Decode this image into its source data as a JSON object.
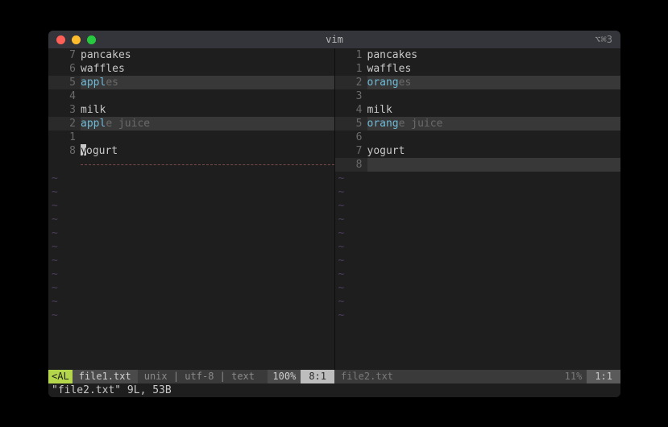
{
  "window": {
    "title": "vim",
    "indicator": "⌥⌘3"
  },
  "left": {
    "lines": [
      {
        "num": "7",
        "text": "pancakes",
        "diff": false
      },
      {
        "num": "6",
        "text": "waffles",
        "diff": false
      },
      {
        "num": "5",
        "pre": "appl",
        "rest": "es",
        "diff": true
      },
      {
        "num": "4",
        "text": "",
        "diff": false
      },
      {
        "num": "3",
        "text": "milk",
        "diff": false
      },
      {
        "num": "2",
        "pre": "appl",
        "rest": "e juice",
        "diff": true
      },
      {
        "num": "1",
        "text": "",
        "diff": false
      },
      {
        "num": "8",
        "cursor": "y",
        "rest": "ogurt",
        "diff": false
      }
    ],
    "fill": true,
    "status": {
      "indicator": "<AL",
      "file": "file1.txt",
      "meta": "unix | utf-8 | text",
      "pct": "100%",
      "pos": "8:1"
    }
  },
  "right": {
    "lines": [
      {
        "num": "1",
        "text": "pancakes",
        "diff": false
      },
      {
        "num": "1",
        "text": "waffles",
        "diff": false
      },
      {
        "num": "2",
        "pre": "orang",
        "rest": "es",
        "diff": true
      },
      {
        "num": "3",
        "text": "",
        "diff": false
      },
      {
        "num": "4",
        "text": "milk",
        "diff": false
      },
      {
        "num": "5",
        "pre": "orang",
        "rest": "e juice",
        "diff": true
      },
      {
        "num": "6",
        "text": "",
        "diff": false
      },
      {
        "num": "7",
        "text": "yogurt",
        "diff": false
      },
      {
        "num": "8",
        "text": "",
        "diff": true
      }
    ],
    "status": {
      "file": "file2.txt",
      "pct": "11%",
      "pos": "1:1"
    }
  },
  "cmdline": "\"file2.txt\" 9L, 53B"
}
